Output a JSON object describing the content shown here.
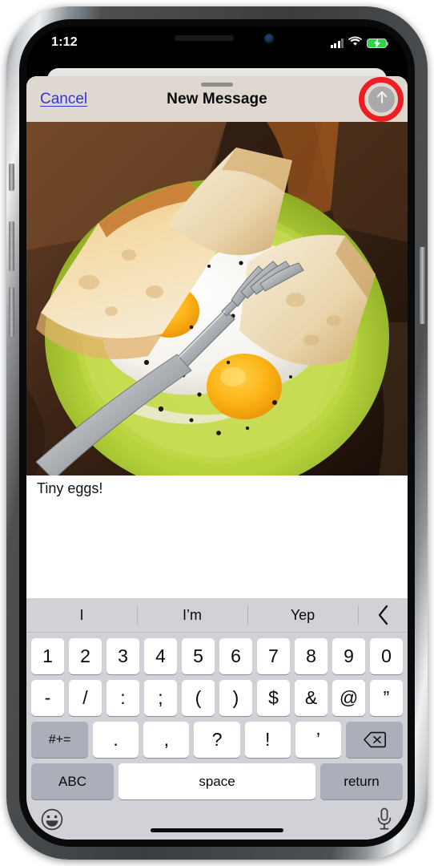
{
  "device": {
    "name": "iphone-x-frame",
    "hardware_buttons": [
      "silent-switch",
      "volume-up",
      "volume-down",
      "power"
    ]
  },
  "status_bar": {
    "time": "1:12",
    "cellular_icon": "signal-bars-icon",
    "wifi_icon": "wifi-icon",
    "battery_icon": "battery-charging-icon",
    "battery_color": "#2cd44a"
  },
  "nav_bar": {
    "cancel_label": "Cancel",
    "title": "New Message",
    "send_icon": "arrow-up-icon",
    "cancel_color": "#3434d6",
    "background": "#ded8d0",
    "highlight_color": "#ee1d23"
  },
  "compose": {
    "attachment_alt": "photo-of-three-fried-eggs-and-toast-on-green-plate",
    "message_text": "Tiny eggs!"
  },
  "keyboard": {
    "predictions": [
      "I",
      "I’m",
      "Yep"
    ],
    "collapse_icon": "chevron-left-icon",
    "row1": [
      "1",
      "2",
      "3",
      "4",
      "5",
      "6",
      "7",
      "8",
      "9",
      "0"
    ],
    "row2": [
      "-",
      "/",
      ":",
      ";",
      "(",
      ")",
      "$",
      "&",
      "@",
      "”"
    ],
    "row3_symbol_key": "#+=",
    "row3": [
      ".",
      ",",
      "?",
      "!",
      "’"
    ],
    "row3_backspace_icon": "backspace-icon",
    "row4": {
      "abc_label": "ABC",
      "space_label": "space",
      "return_label": "return"
    },
    "bottom": {
      "emoji_icon": "emoji-smiley-icon",
      "dictation_icon": "microphone-icon"
    },
    "background": "#d0d2d8",
    "key_color": "#ffffff",
    "modifier_key_color": "#abafb9"
  },
  "home_indicator": "home-indicator-bar"
}
